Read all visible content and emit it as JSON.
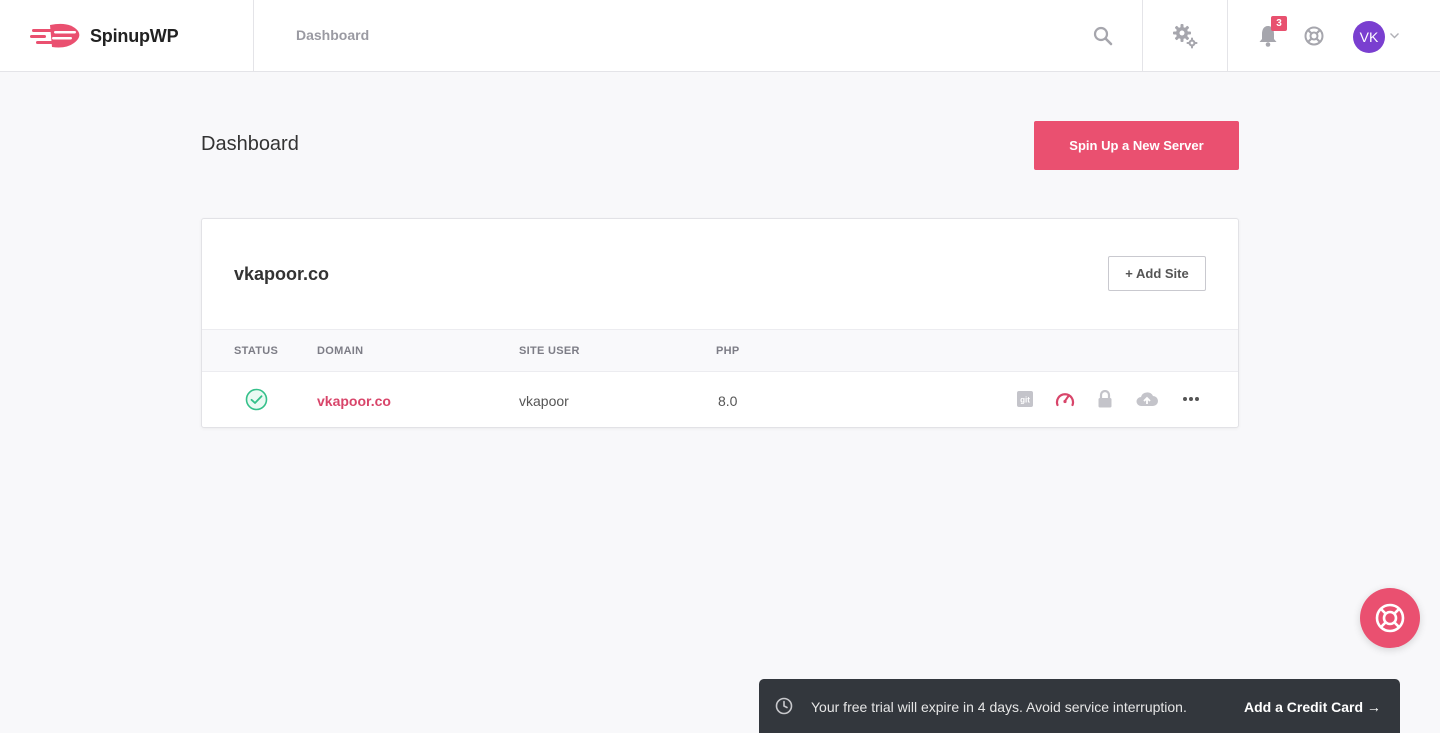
{
  "app": {
    "brand": "SpinupWP",
    "brand_color": "#ea5070"
  },
  "topbar": {
    "breadcrumb": "Dashboard",
    "notification_count": "3",
    "user_initials": "VK",
    "icons": [
      "search-icon",
      "settings-gears-icon",
      "bell-icon",
      "help-globe-icon",
      "chevron-down-icon"
    ]
  },
  "page": {
    "title": "Dashboard",
    "primary_button": "Spin Up a New Server"
  },
  "server": {
    "name": "vkapoor.co",
    "add_site_label": "+ Add Site",
    "columns": [
      "STATUS",
      "DOMAIN",
      "SITE USER",
      "PHP"
    ],
    "sites": [
      {
        "status": "ok",
        "domain": "vkapoor.co",
        "site_user": "vkapoor",
        "php": "8.0",
        "actions": [
          "git-icon",
          "page-cache-gauge-icon",
          "https-lock-icon",
          "backup-cloud-icon",
          "more-actions-icon"
        ]
      }
    ]
  },
  "trial_banner": {
    "message": "Your free trial will expire in 4 days. Avoid service interruption.",
    "link": "Add a Credit Card →"
  },
  "colors": {
    "accent": "#ea5070",
    "status_ok": "#34c08a",
    "avatar": "#7a3fd0",
    "banner_bg": "#33373d"
  }
}
